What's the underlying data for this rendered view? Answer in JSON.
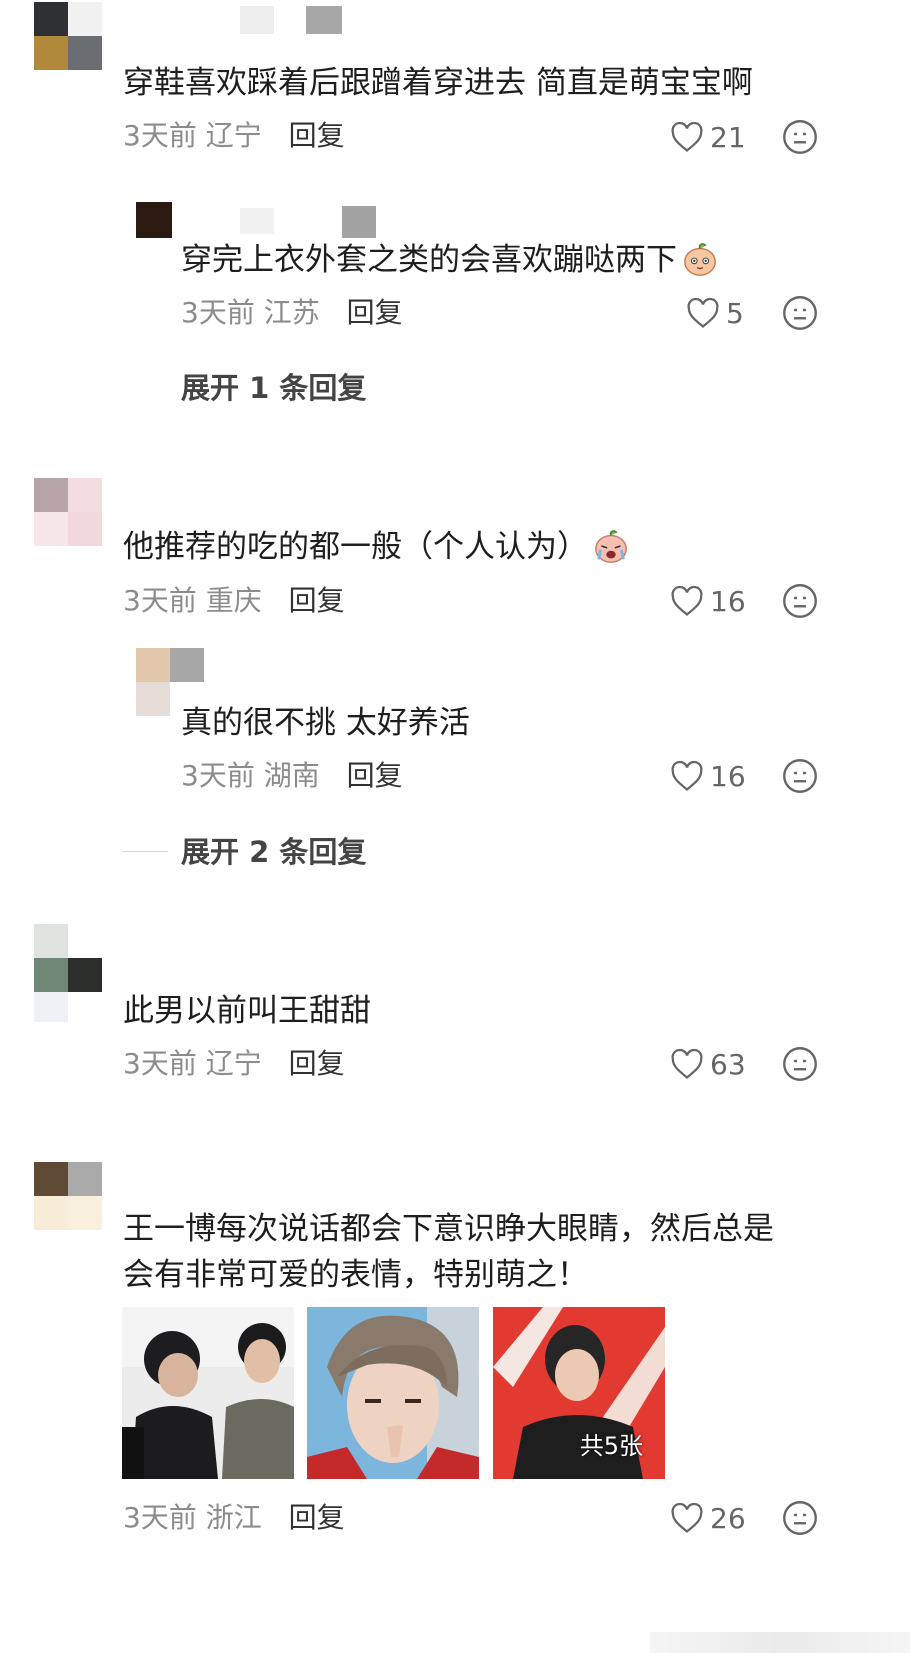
{
  "comments": [
    {
      "text": "穿鞋喜欢踩着后跟蹭着穿进去 简直是萌宝宝啊",
      "time": "3天前",
      "location": "辽宁",
      "reply_label": "回复",
      "likes": "21",
      "replies": [
        {
          "text": "穿完上衣外套之类的会喜欢蹦哒两下",
          "time": "3天前",
          "location": "江苏",
          "reply_label": "回复",
          "likes": "5"
        }
      ],
      "expand_label": "展开 1 条回复"
    },
    {
      "text": "他推荐的吃的都一般（个人认为）",
      "time": "3天前",
      "location": "重庆",
      "reply_label": "回复",
      "likes": "16",
      "replies": [
        {
          "text": "真的很不挑 太好养活",
          "time": "3天前",
          "location": "湖南",
          "reply_label": "回复",
          "likes": "16"
        }
      ],
      "expand_label": "展开 2 条回复"
    },
    {
      "text": "此男以前叫王甜甜",
      "time": "3天前",
      "location": "辽宁",
      "reply_label": "回复",
      "likes": "63"
    },
    {
      "text_line1": "王一博每次说话都会下意识睁大眼睛，然后总是",
      "text_line2": "会有非常可爱的表情，特别萌之！",
      "time": "3天前",
      "location": "浙江",
      "reply_label": "回复",
      "likes": "26",
      "image_count_label": "共5张"
    }
  ],
  "icons": {
    "like": "heart-outline-icon",
    "emoji": "neutral-face-icon"
  },
  "colors": {
    "text": "#1e1e1e",
    "meta": "#8c8c8c",
    "icon": "#666666"
  }
}
